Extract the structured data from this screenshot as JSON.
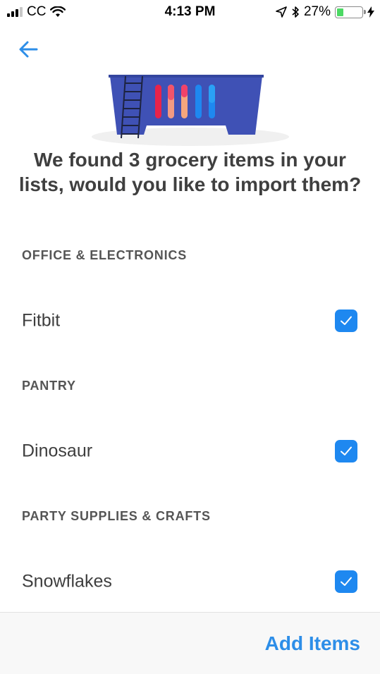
{
  "status_bar": {
    "carrier": "CC",
    "time": "4:13 PM",
    "battery_percent_label": "27%",
    "battery_level": 0.27,
    "icons": [
      "signal-icon",
      "wifi-icon",
      "location-arrow-icon",
      "bluetooth-icon",
      "battery-icon",
      "charging-bolt-icon"
    ]
  },
  "navigation": {
    "back_icon": "arrow-left-icon"
  },
  "hero": {
    "icon": "grocery-basket-illustration"
  },
  "headline": "We found 3 grocery items in your lists, would you like to import them?",
  "sections": [
    {
      "header": "OFFICE & ELECTRONICS",
      "items": [
        {
          "label": "Fitbit",
          "checked": true
        }
      ]
    },
    {
      "header": "PANTRY",
      "items": [
        {
          "label": "Dinosaur",
          "checked": true
        }
      ]
    },
    {
      "header": "PARTY SUPPLIES & CRAFTS",
      "items": [
        {
          "label": "Snowflakes",
          "checked": true
        }
      ]
    }
  ],
  "footer": {
    "add_items_label": "Add Items"
  },
  "colors": {
    "accent": "#1e88f0",
    "button_text": "#2d8ee8",
    "basket": "#3f51b5"
  }
}
